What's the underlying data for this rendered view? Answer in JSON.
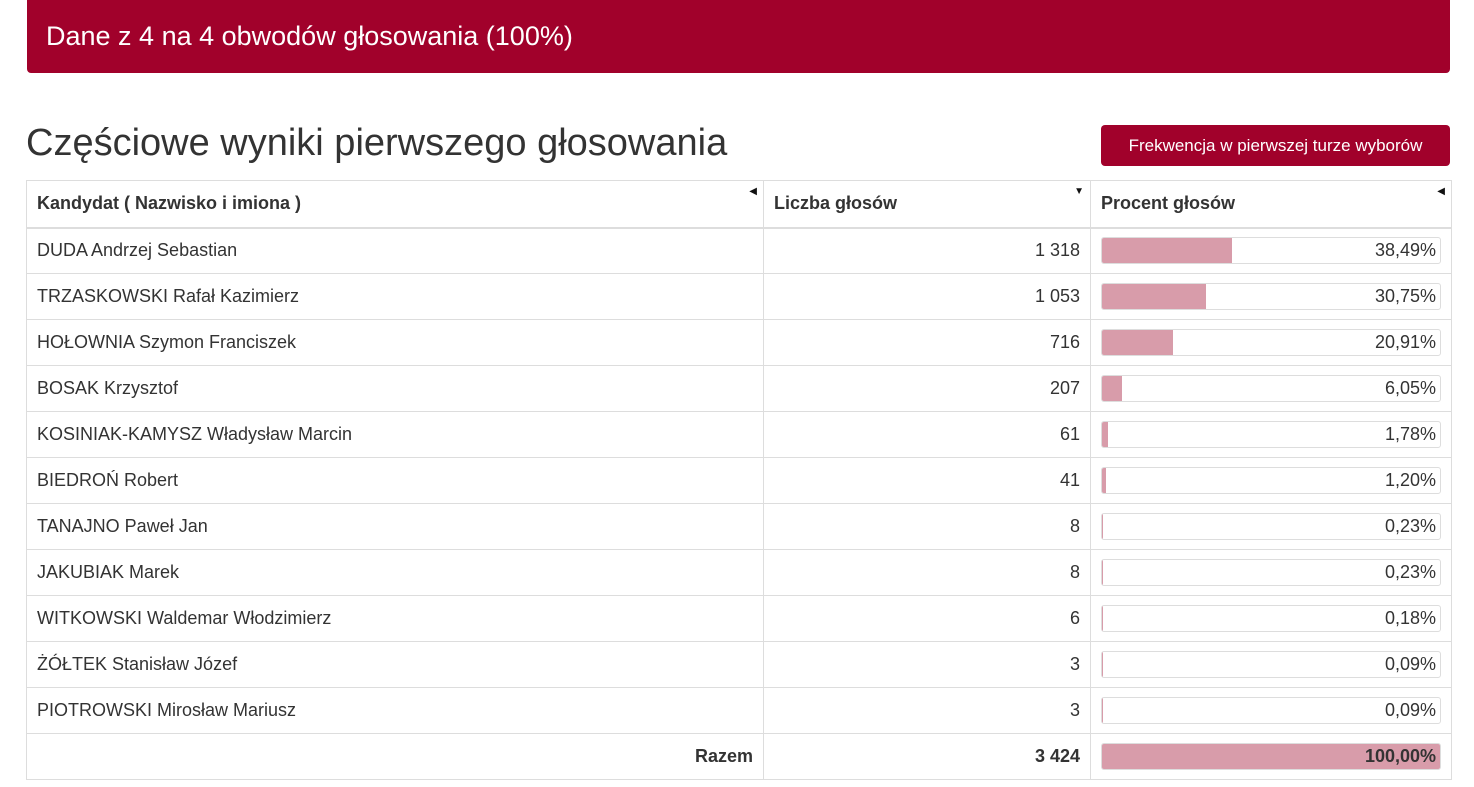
{
  "banner": {
    "text": "Dane z 4 na 4 obwodów głosowania (100%)"
  },
  "page_title": "Częściowe wyniki pierwszego głosowania",
  "turnout_button": "Frekwencja w pierwszej turze wyborów",
  "colors": {
    "accent": "#a1012b",
    "bar_fill": "#d89caa",
    "border": "#dddddd"
  },
  "table": {
    "headers": {
      "candidate": "Kandydat ( Nazwisko i imiona )",
      "votes": "Liczba głosów",
      "percent": "Procent głosów"
    },
    "sort_icons": {
      "candidate": "sort-left-icon",
      "votes": "sort-down-icon",
      "percent": "sort-left-icon"
    },
    "rows": [
      {
        "name": "DUDA Andrzej Sebastian",
        "votes": "1 318",
        "percent": "38,49%",
        "share": 0.3849
      },
      {
        "name": "TRZASKOWSKI Rafał Kazimierz",
        "votes": "1 053",
        "percent": "30,75%",
        "share": 0.3075
      },
      {
        "name": "HOŁOWNIA Szymon Franciszek",
        "votes": "716",
        "percent": "20,91%",
        "share": 0.2091
      },
      {
        "name": "BOSAK Krzysztof",
        "votes": "207",
        "percent": "6,05%",
        "share": 0.0605
      },
      {
        "name": "KOSINIAK-KAMYSZ Władysław Marcin",
        "votes": "61",
        "percent": "1,78%",
        "share": 0.0178
      },
      {
        "name": "BIEDROŃ Robert",
        "votes": "41",
        "percent": "1,20%",
        "share": 0.012
      },
      {
        "name": "TANAJNO Paweł Jan",
        "votes": "8",
        "percent": "0,23%",
        "share": 0.0023
      },
      {
        "name": "JAKUBIAK Marek",
        "votes": "8",
        "percent": "0,23%",
        "share": 0.0023
      },
      {
        "name": "WITKOWSKI Waldemar Włodzimierz",
        "votes": "6",
        "percent": "0,18%",
        "share": 0.0018
      },
      {
        "name": "ŻÓŁTEK Stanisław Józef",
        "votes": "3",
        "percent": "0,09%",
        "share": 0.0009
      },
      {
        "name": "PIOTROWSKI Mirosław Mariusz",
        "votes": "3",
        "percent": "0,09%",
        "share": 0.0009
      }
    ],
    "total": {
      "label": "Razem",
      "votes": "3 424",
      "percent": "100,00%",
      "share": 1.0
    }
  }
}
